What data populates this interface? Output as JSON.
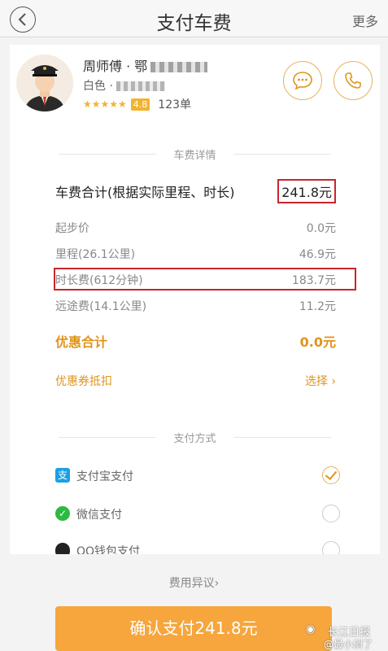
{
  "header": {
    "title": "支付车费",
    "more_label": "更多"
  },
  "driver": {
    "name": "周师傅 · 鄂",
    "car_color": "白色 ·",
    "stars": "★★★★★",
    "score": "4.8",
    "orders": "123单"
  },
  "fare": {
    "section_title": "车费详情",
    "total_label": "车费合计(根据实际里程、时长)",
    "total_value": "241.8元",
    "items": [
      {
        "label": "起步价",
        "value": "0.0元"
      },
      {
        "label": "里程(26.1公里)",
        "value": "46.9元"
      },
      {
        "label": "时长费(612分钟)",
        "value": "183.7元"
      },
      {
        "label": "远途费(14.1公里)",
        "value": "11.2元"
      }
    ],
    "discount_label": "优惠合计",
    "discount_value": "0.0元",
    "coupon_label": "优惠券抵扣",
    "coupon_action": "选择 ›"
  },
  "payment": {
    "section_title": "支付方式",
    "methods": [
      {
        "label": "支付宝支付",
        "icon": "alipay-icon",
        "selected": true
      },
      {
        "label": "微信支付",
        "icon": "wechat-icon",
        "selected": false
      },
      {
        "label": "QQ钱包支付",
        "icon": "qq-icon",
        "selected": false
      }
    ]
  },
  "dispute_label": "费用异议›",
  "confirm_label": "确认支付241.8元",
  "watermark": {
    "line1": "长江日报",
    "line2": "@最小消了"
  },
  "colors": {
    "accent": "#f6a63c",
    "highlight_red": "#c9252c",
    "discount": "#e0941c"
  }
}
